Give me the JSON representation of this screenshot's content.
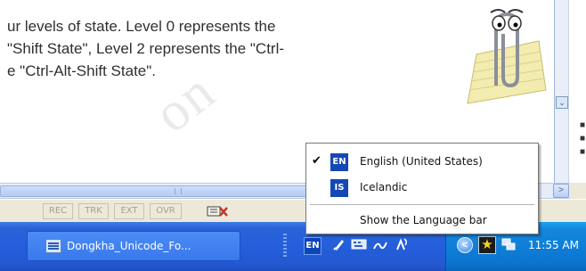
{
  "document": {
    "lines": [
      "ur levels of state. Level 0 represents the",
      "\"Shift State\", Level 2 represents the \"Ctrl-",
      "e \"Ctrl-Alt-Shift State\"."
    ]
  },
  "statusbar": {
    "cells": [
      "REC",
      "TRK",
      "EXT",
      "OVR"
    ]
  },
  "language_menu": {
    "items": [
      {
        "code": "EN",
        "label": "English (United States)",
        "checked": true
      },
      {
        "code": "IS",
        "label": "Icelandic",
        "checked": false
      }
    ],
    "show_language_bar": "Show the Language bar"
  },
  "taskbar": {
    "window_button": "Dongkha_Unicode_Fo...",
    "language_indicator": "EN",
    "clock": "11:55 AM",
    "icons": [
      "pen-icon",
      "keyboard-icon",
      "handwriting-icon",
      "speech-icon",
      "chevron-left-icon",
      "star-icon",
      "network-icon"
    ]
  },
  "colors": {
    "taskbar_blue": "#245edb",
    "tray_blue": "#0f7fd8",
    "lang_badge": "#1448b5"
  }
}
